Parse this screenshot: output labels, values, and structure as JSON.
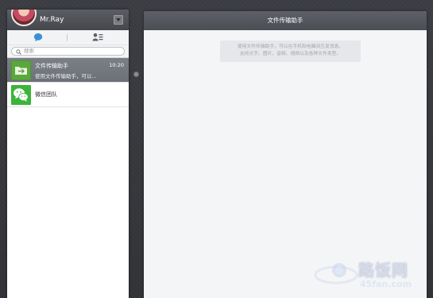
{
  "profile": {
    "user_name": "Mr.Ray"
  },
  "search": {
    "placeholder": "搜索"
  },
  "conversations": [
    {
      "name": "文件传输助手",
      "preview": "使用文件传输助手，可以...",
      "time": "10:20",
      "active": true,
      "icon": "folder-icon"
    },
    {
      "name": "微信团队",
      "preview": "",
      "time": "",
      "active": false,
      "icon": "wechat-logo-icon"
    }
  ],
  "chat": {
    "title": "文件传输助手",
    "notice_line1": "使用文件传输助手，可以在手机和电脑间互发消息。",
    "notice_line2": "支持文字、图片、音频、视频以及各种文件类型。"
  },
  "watermark": {
    "brand": "路饭网",
    "url": "45fan.com"
  },
  "colors": {
    "header": "#4b4e54",
    "active_item": "#737780",
    "panel_bg": "#f4f5f7",
    "backdrop": "#37383c",
    "wechat_green": "#3bb43a"
  }
}
